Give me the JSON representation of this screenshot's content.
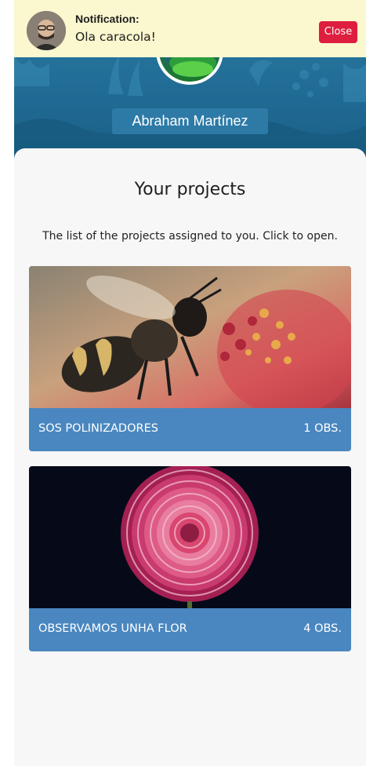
{
  "notification": {
    "title": "Notification:",
    "message": "Ola caracola!",
    "close_label": "Close"
  },
  "profile": {
    "name": "Abraham Martínez"
  },
  "projects_section": {
    "title": "Your projects",
    "description": "The list of the projects assigned to you. Click to open."
  },
  "projects": [
    {
      "name": "SOS POLINIZADORES",
      "count": "1 OBS.",
      "image_icon": "bee-on-flower-image"
    },
    {
      "name": "OBSERVAMOS UNHA FLOR",
      "count": "4 OBS.",
      "image_icon": "pink-dahlia-image"
    }
  ],
  "colors": {
    "header_blue": "#1f6a93",
    "card_footer_blue": "#4a87c0",
    "notification_bg": "#fbf7cf",
    "close_red": "#de1e3e"
  }
}
